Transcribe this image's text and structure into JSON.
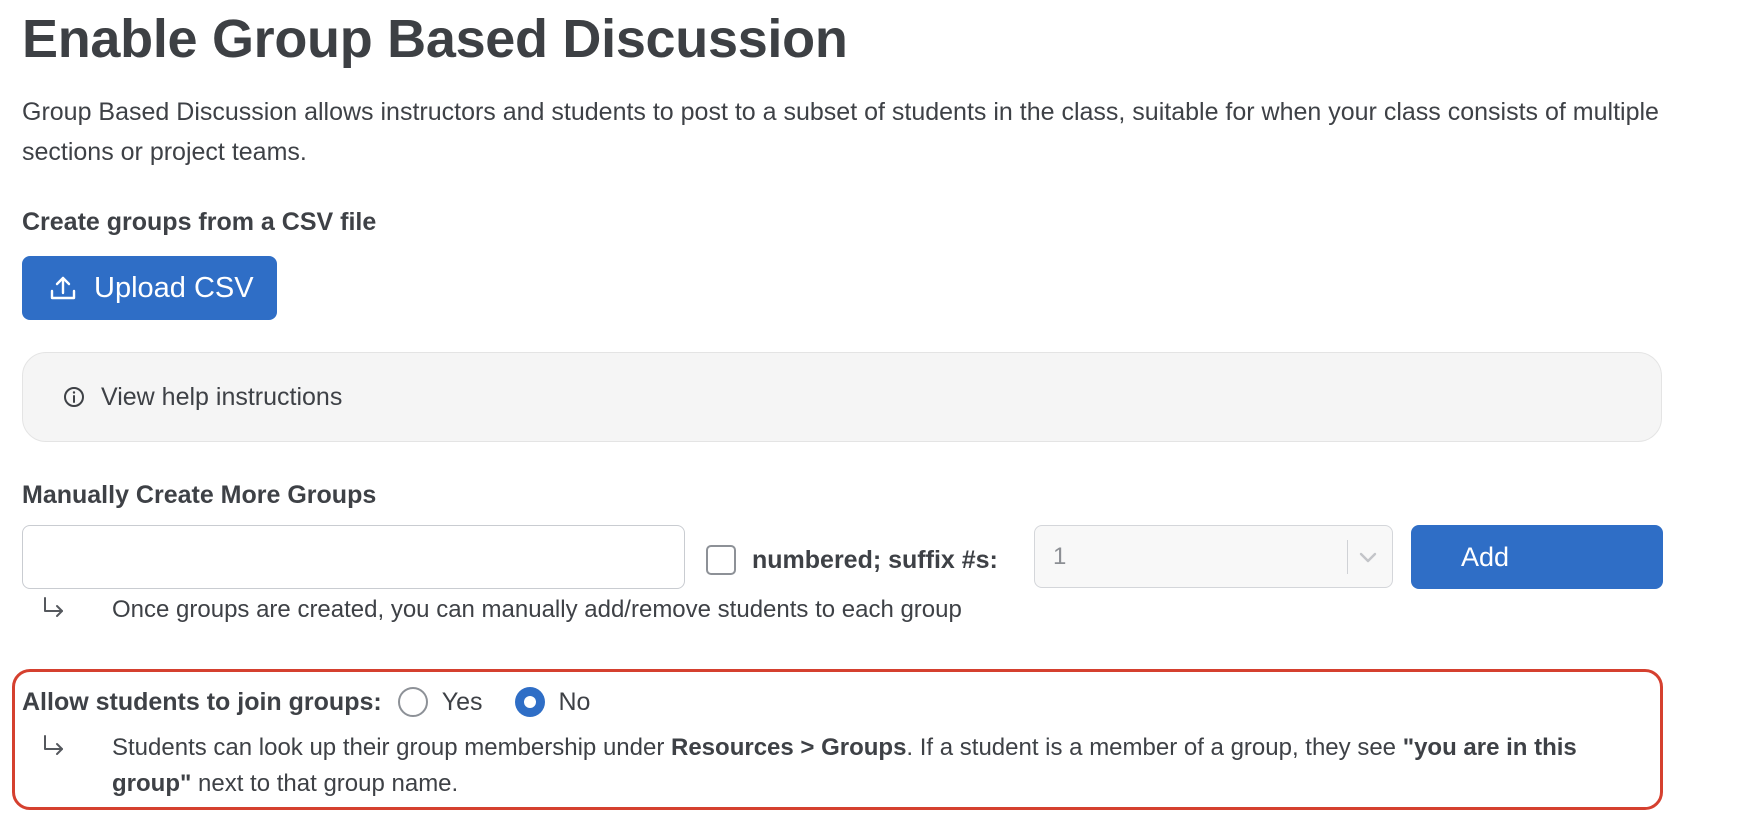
{
  "page": {
    "title": "Enable Group Based Discussion",
    "intro": "Group Based Discussion allows instructors and students to post to a subset of students in the class, suitable for when your class consists of multiple sections or project teams."
  },
  "csv": {
    "label": "Create groups from a CSV file",
    "upload_button": "Upload CSV",
    "upload_icon": "upload-icon"
  },
  "help": {
    "label": "View help instructions",
    "icon": "info-icon"
  },
  "manual": {
    "label": "Manually Create More Groups",
    "name_input_value": "",
    "numbered_checked": false,
    "numbered_label": "numbered; suffix #s:",
    "suffix_value": "1",
    "add_button": "Add",
    "hint": "Once groups are created, you can manually add/remove students to each group"
  },
  "join": {
    "label": "Allow students to join groups:",
    "options": [
      "Yes",
      "No"
    ],
    "selected": "No",
    "hint_part1": "Students can look up their group membership under ",
    "hint_bold1": "Resources > Groups",
    "hint_part2": ". If a student is a member of a group, they see ",
    "hint_bold2": "\"you are in this group\"",
    "hint_part3": " next to that group name."
  },
  "colors": {
    "primary": "#2f6ec6",
    "highlight_border": "#d5402f",
    "help_bg": "#f5f5f5",
    "text": "#3e4146"
  }
}
